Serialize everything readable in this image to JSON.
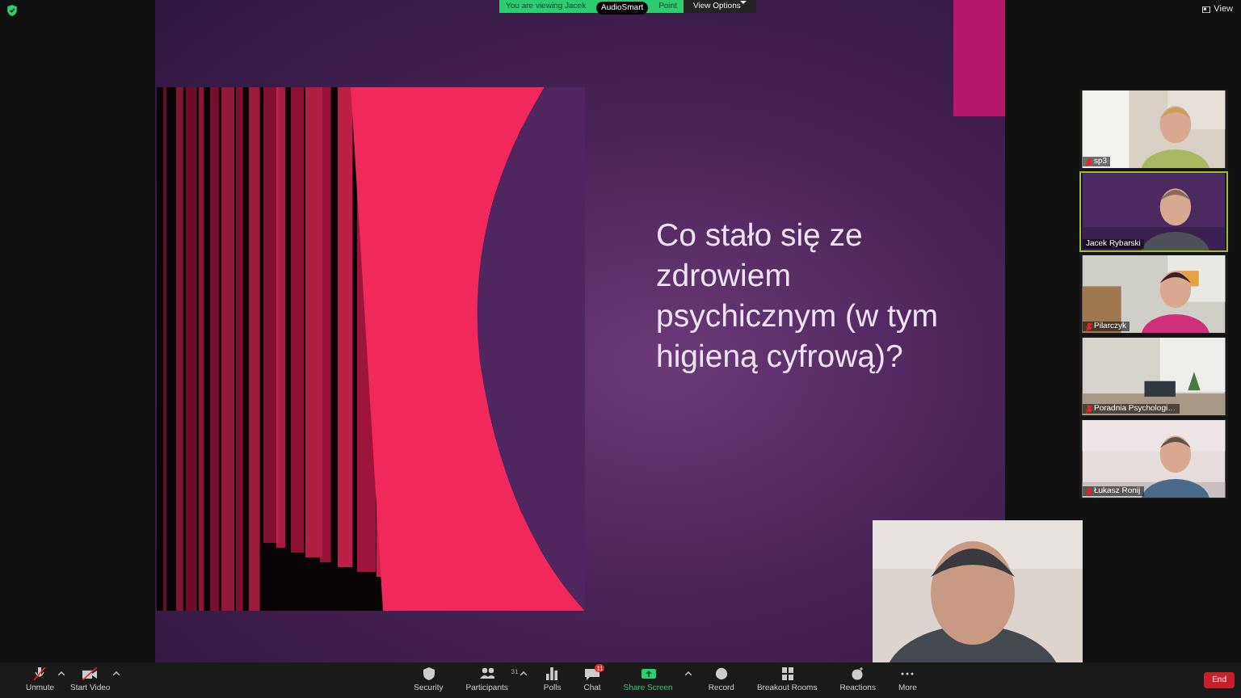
{
  "top_bar": {
    "view_label": "View"
  },
  "share_banner": {
    "text": "You are viewing Jacek",
    "text_end": "Point",
    "overlay_label": "AudioSmart",
    "view_options": "View Options"
  },
  "slide": {
    "title": "Co stało się ze zdrowiem psychicznym (w tym higieną cyfrową)?"
  },
  "participants": [
    {
      "name": "sp3",
      "muted": true,
      "active_speaker": false
    },
    {
      "name": "Jacek Rybarski",
      "muted": false,
      "active_speaker": true
    },
    {
      "name": "Pilarczyk",
      "muted": true,
      "active_speaker": false
    },
    {
      "name": "Poradnia Psychologi…",
      "muted": true,
      "active_speaker": false
    },
    {
      "name": "Łukasz Ronij",
      "muted": true,
      "active_speaker": false
    }
  ],
  "toolbar": {
    "left": [
      {
        "label": "Unmute",
        "kind": "mic",
        "caret": true
      },
      {
        "label": "Start Video",
        "kind": "video",
        "caret": true
      }
    ],
    "center": [
      {
        "label": "Security",
        "kind": "shield",
        "caret": false
      },
      {
        "label": "Participants",
        "kind": "people",
        "count": "31",
        "caret": true
      },
      {
        "label": "Polls",
        "kind": "polls",
        "caret": false
      },
      {
        "label": "Chat",
        "kind": "chat",
        "badge": "11",
        "caret": false
      },
      {
        "label": "Share Screen",
        "kind": "share",
        "caret": true
      },
      {
        "label": "Record",
        "kind": "record",
        "caret": false
      },
      {
        "label": "Breakout Rooms",
        "kind": "rooms",
        "caret": false
      },
      {
        "label": "Reactions",
        "kind": "reactions",
        "caret": false
      },
      {
        "label": "More",
        "kind": "more",
        "caret": false
      }
    ],
    "end_button": "End"
  }
}
